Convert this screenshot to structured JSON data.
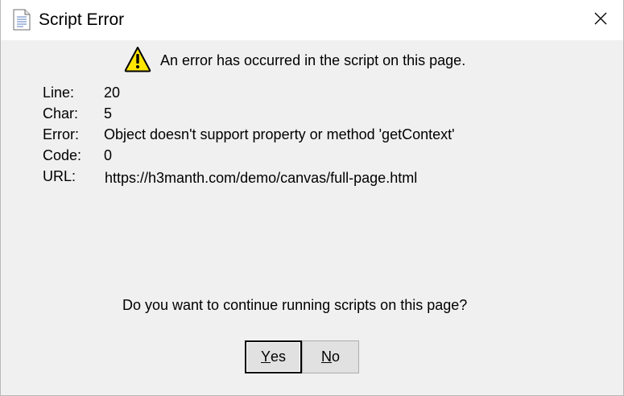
{
  "window": {
    "title": "Script Error",
    "title_icon": "document-icon",
    "close_icon": "close-icon"
  },
  "message": {
    "icon": "warning-icon",
    "text": "An error has occurred in the script on this page."
  },
  "details": {
    "line_label": "Line:",
    "line_value": "20",
    "char_label": "Char:",
    "char_value": "5",
    "error_label": "Error:",
    "error_value": "Object doesn't support property or method 'getContext'",
    "code_label": "Code:",
    "code_value": "0",
    "url_label": "URL:",
    "url_value": "https://h3manth.com/demo/canvas/full-page.html"
  },
  "question": "Do you want to continue running scripts on this page?",
  "buttons": {
    "yes_mnemonic": "Y",
    "yes_rest": "es",
    "no_mnemonic": "N",
    "no_rest": "o"
  },
  "colors": {
    "dialog_bg": "#f0f0f0",
    "titlebar_bg": "#ffffff",
    "warning_fill": "#ffe500",
    "button_bg": "#e1e1e1"
  }
}
